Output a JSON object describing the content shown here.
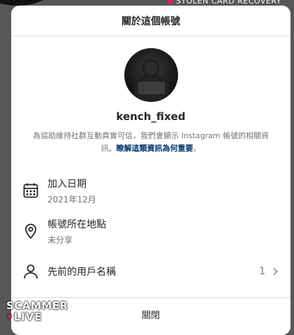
{
  "backdrop": {
    "recovery_text": "STOLEN CARD RECOVERY"
  },
  "modal": {
    "title": "關於這個帳號",
    "username": "kench_fixed",
    "description": "為協助維持社群互動真實可信，我們會顯示 Instagram 帳號的相關資訊。",
    "description_link": "瞭解這類資訊為何重要",
    "description_end": "。",
    "rows": [
      {
        "icon": "calendar-icon",
        "title": "加入日期",
        "sub": "2021年12月"
      },
      {
        "icon": "location-pin-icon",
        "title": "帳號所在地點",
        "sub": "未分享"
      },
      {
        "icon": "person-icon",
        "title": "先前的用戶名稱",
        "count": "1"
      }
    ],
    "close_label": "關閉"
  },
  "watermark": {
    "line1": "SCAMMER",
    "line2": "LIVE"
  },
  "colors": {
    "link": "#00376b",
    "divider": "#dbdbdb",
    "overlay": "#575757"
  }
}
